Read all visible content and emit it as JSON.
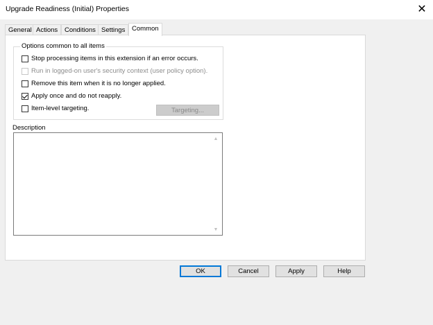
{
  "window": {
    "title": "Upgrade Readiness (Initial) Properties",
    "close_glyph": "✕"
  },
  "tabs": [
    {
      "label": "General",
      "active": false
    },
    {
      "label": "Actions",
      "active": false
    },
    {
      "label": "Conditions",
      "active": false
    },
    {
      "label": "Settings",
      "active": false
    },
    {
      "label": "Common",
      "active": true
    }
  ],
  "options_group": {
    "legend": "Options common to all items",
    "options": [
      {
        "label": "Stop processing items in this extension if an error occurs.",
        "checked": false,
        "enabled": true
      },
      {
        "label": "Run in logged-on user's security context (user policy option).",
        "checked": false,
        "enabled": false
      },
      {
        "label": "Remove this item when it is no longer applied.",
        "checked": false,
        "enabled": true
      },
      {
        "label": "Apply once and do not reapply.",
        "checked": true,
        "enabled": true
      },
      {
        "label": "Item-level targeting.",
        "checked": false,
        "enabled": true
      }
    ],
    "targeting_button": "Targeting..."
  },
  "description": {
    "label": "Description",
    "value": ""
  },
  "buttons": {
    "ok": "OK",
    "cancel": "Cancel",
    "apply": "Apply",
    "help": "Help"
  },
  "icons": {
    "scroll_up": "scroll-up-arrow-icon",
    "scroll_down": "scroll-down-arrow-icon",
    "close": "close-icon"
  },
  "colors": {
    "default_button_border": "#0078d7",
    "panel_bg": "#ffffff",
    "dialog_bg": "#f0f0f0"
  }
}
